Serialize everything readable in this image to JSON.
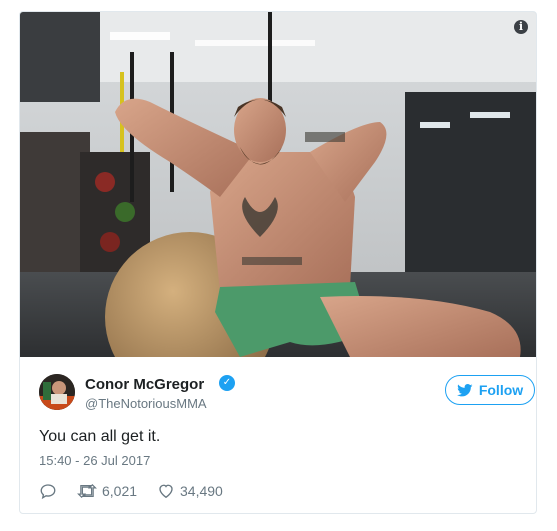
{
  "tweet": {
    "author": {
      "name": "Conor McGregor",
      "handle": "@TheNotoriousMMA",
      "verified": true,
      "avatar_icon": "avatar-photo"
    },
    "follow_label": "Follow",
    "text": "You can all get it.",
    "timestamp": "15:40 - 26 Jul 2017",
    "actions": {
      "reply_icon": "reply-icon",
      "retweet_icon": "retweet-icon",
      "retweet_count": "6,021",
      "like_icon": "heart-icon",
      "like_count": "34,490"
    },
    "media": {
      "info_icon": "i"
    }
  },
  "colors": {
    "accent": "#1da1f2",
    "text": "#1c2022",
    "muted": "#697882",
    "border": "#e1e8ed"
  }
}
